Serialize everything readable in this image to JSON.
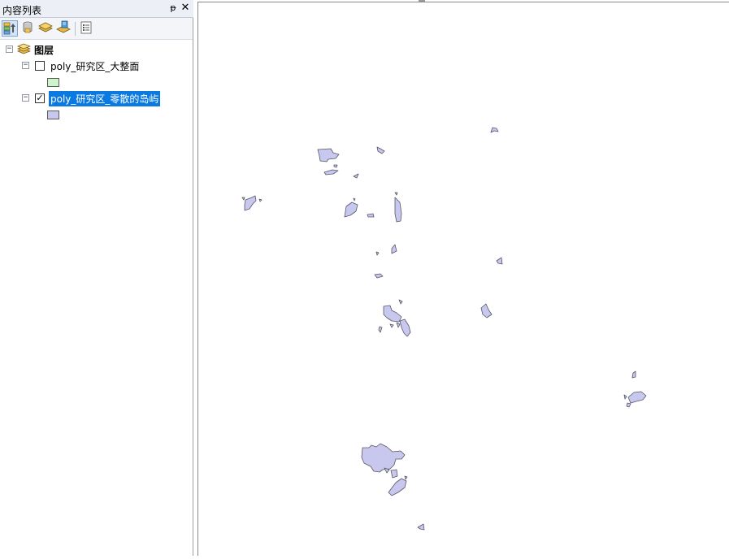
{
  "toc": {
    "title": "内容列表",
    "pin_symbol": "ᵽ",
    "close_symbol": "✕",
    "toolbar": [
      {
        "name": "list-by-drawing-order-button",
        "icon": "drawing-order-icon",
        "active": true
      },
      {
        "name": "list-by-source-button",
        "icon": "database-icon",
        "active": false
      },
      {
        "name": "list-by-visibility-button",
        "icon": "layers-visibility-icon",
        "active": false
      },
      {
        "name": "list-by-selection-button",
        "icon": "selection-layers-icon",
        "active": false
      },
      {
        "name": "options-button",
        "icon": "options-list-icon",
        "active": false
      }
    ],
    "group": {
      "label": "图层",
      "expander": "⊟"
    },
    "layers": [
      {
        "label": "poly_研究区_大整面",
        "checked": false,
        "swatch_color": "#ccf5cc",
        "selected": false
      },
      {
        "label": "poly_研究区_零散的岛屿",
        "checked": true,
        "swatch_color": "#c8c8ee",
        "selected": true
      }
    ]
  },
  "map": {
    "island_fill": "#c8c8ee",
    "island_stroke": "#555566",
    "background": "#ffffff"
  }
}
